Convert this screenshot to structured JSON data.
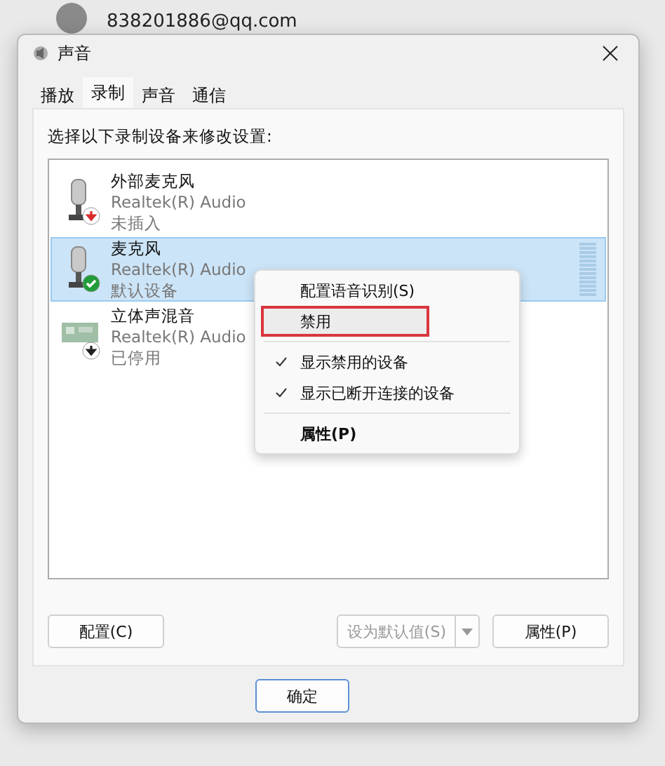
{
  "background": {
    "account": "838201886@qq.com"
  },
  "window": {
    "title": "声音"
  },
  "tabs": [
    {
      "label": "播放",
      "selected": false
    },
    {
      "label": "录制",
      "selected": true
    },
    {
      "label": "声音",
      "selected": false
    },
    {
      "label": "通信",
      "selected": false
    }
  ],
  "instruction": "选择以下录制设备来修改设置:",
  "devices": [
    {
      "name": "外部麦克风",
      "driver": "Realtek(R) Audio",
      "status": "未插入",
      "kind": "microphone",
      "badge": {
        "kind": "unplugged"
      },
      "selected": false
    },
    {
      "name": "麦克风",
      "driver": "Realtek(R) Audio",
      "status": "默认设备",
      "kind": "microphone",
      "badge": {
        "kind": "default"
      },
      "selected": true
    },
    {
      "name": "立体声混音",
      "driver": "Realtek(R) Audio",
      "status": "已停用",
      "kind": "board",
      "badge": {
        "kind": "disabled"
      },
      "selected": false
    }
  ],
  "context_menu": {
    "items": [
      {
        "kind": "item",
        "label": "配置语音识别(S)",
        "checked": false,
        "highlighted": false,
        "bold": false
      },
      {
        "kind": "item",
        "label": "禁用",
        "checked": false,
        "highlighted": true,
        "bold": false
      },
      {
        "kind": "separator"
      },
      {
        "kind": "item",
        "label": "显示禁用的设备",
        "checked": true,
        "highlighted": false,
        "bold": false
      },
      {
        "kind": "item",
        "label": "显示已断开连接的设备",
        "checked": true,
        "highlighted": false,
        "bold": false
      },
      {
        "kind": "separator"
      },
      {
        "kind": "item",
        "label": "属性(P)",
        "checked": false,
        "highlighted": false,
        "bold": true
      }
    ]
  },
  "buttons": {
    "configure": {
      "label": "配置(C)",
      "disabled": false
    },
    "set_default": {
      "label": "设为默认值(S)",
      "disabled": true
    },
    "properties": {
      "label": "属性(P)",
      "disabled": false
    }
  },
  "footer_buttons": [
    {
      "label": "确定",
      "default": true
    }
  ]
}
